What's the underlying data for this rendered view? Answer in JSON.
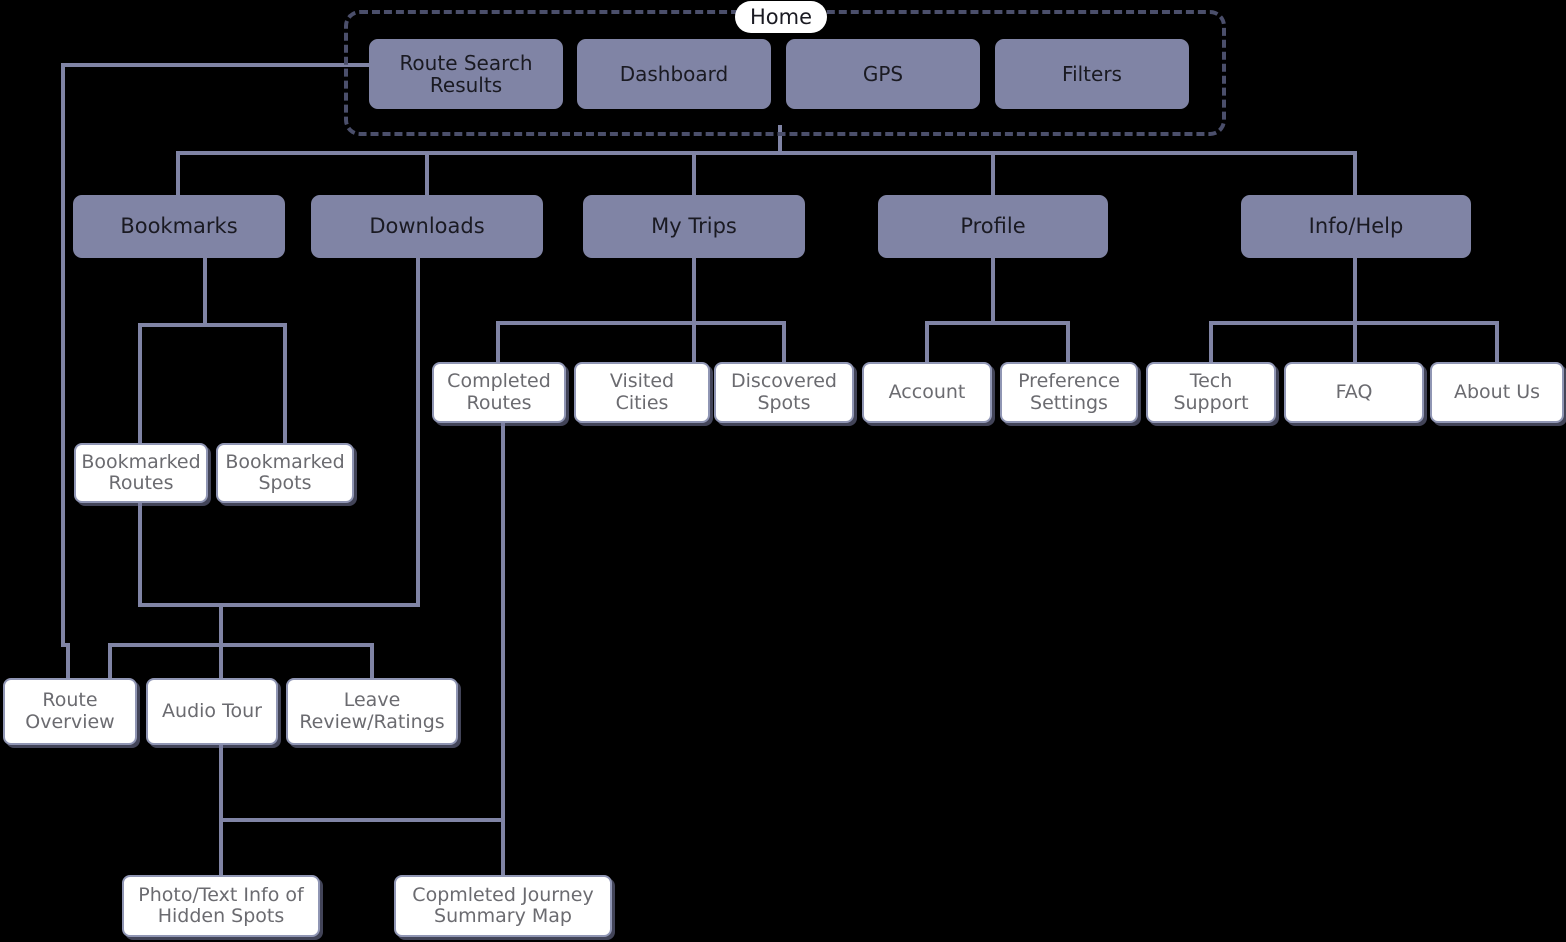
{
  "diagram": {
    "title": "Home",
    "type": "sitemap",
    "background_color": "#000000",
    "colors": {
      "primary_node_fill": "#8084a5",
      "leaf_node_fill": "#ffffff",
      "leaf_node_border": "#9096b4",
      "connector": "#8084a5",
      "group_border": "#4b4f6b",
      "primary_text": "#1a1a22",
      "leaf_text": "#6b6b70"
    }
  },
  "group": {
    "label": "Home",
    "items": [
      {
        "id": "route-search-results",
        "label": "Route Search Results"
      },
      {
        "id": "dashboard",
        "label": "Dashboard"
      },
      {
        "id": "gps",
        "label": "GPS"
      },
      {
        "id": "filters",
        "label": "Filters"
      }
    ]
  },
  "level2": [
    {
      "id": "bookmarks",
      "label": "Bookmarks"
    },
    {
      "id": "downloads",
      "label": "Downloads"
    },
    {
      "id": "my-trips",
      "label": "My Trips"
    },
    {
      "id": "profile",
      "label": "Profile"
    },
    {
      "id": "info-help",
      "label": "Info/Help"
    }
  ],
  "level3": [
    {
      "id": "completed-routes",
      "label": "Completed Routes"
    },
    {
      "id": "visited-cities",
      "label": "Visited Cities"
    },
    {
      "id": "discovered-spots",
      "label": "Discovered Spots"
    },
    {
      "id": "account",
      "label": "Account"
    },
    {
      "id": "preference-settings",
      "label": "Preference Settings"
    },
    {
      "id": "tech-support",
      "label": "Tech Support"
    },
    {
      "id": "faq",
      "label": "FAQ"
    },
    {
      "id": "about-us",
      "label": "About Us"
    }
  ],
  "bookmark_children": [
    {
      "id": "bookmarked-routes",
      "label": "Bookmarked Routes"
    },
    {
      "id": "bookmarked-spots",
      "label": "Bookmarked Spots"
    }
  ],
  "detail_nodes": [
    {
      "id": "route-overview",
      "label": "Route Overview"
    },
    {
      "id": "audio-tour",
      "label": "Audio Tour"
    },
    {
      "id": "leave-review-ratings",
      "label": "Leave Review/Ratings"
    }
  ],
  "bottom_nodes": [
    {
      "id": "photo-text-info-hidden-spots",
      "label": "Photo/Text Info of Hidden Spots"
    },
    {
      "id": "completed-journey-summary-map",
      "label": "Copmleted Journey Summary Map"
    }
  ]
}
